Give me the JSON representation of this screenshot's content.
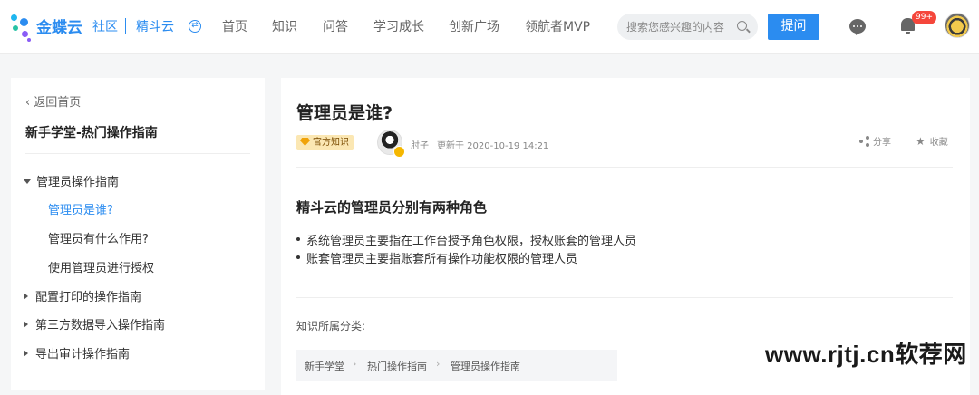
{
  "header": {
    "brand": "金蝶云",
    "brand_sub": "社区",
    "product": "精斗云",
    "nav": [
      "首页",
      "知识",
      "问答",
      "学习成长",
      "创新广场",
      "领航者MVP"
    ],
    "search_placeholder": "搜索您感兴趣的内容",
    "ask_label": "提问",
    "badge": "99+"
  },
  "sidebar": {
    "back_label": "返回首页",
    "title": "新手学堂-热门操作指南",
    "group": "管理员操作指南",
    "children": [
      "管理员是谁?",
      "管理员有什么作用?",
      "使用管理员进行授权"
    ],
    "collapsed": [
      "配置打印的操作指南",
      "第三方数据导入操作指南",
      "导出审计操作指南"
    ]
  },
  "article": {
    "title": "管理员是谁?",
    "official_tag": "官方知识",
    "author": "肘子",
    "updated": "更新于 2020-10-19 14:21",
    "share_label": "分享",
    "fav_label": "收藏",
    "section_heading": "精斗云的管理员分别有两种角色",
    "bullets": [
      "系统管理员主要指在工作台授予角色权限，授权账套的管理人员",
      "账套管理员主要指账套所有操作功能权限的管理人员"
    ],
    "category_label": "知识所属分类:",
    "breadcrumb": [
      "新手学堂",
      "热门操作指南",
      "管理员操作指南"
    ]
  },
  "watermark": "www.rjtj.cn软荐网",
  "colors": {
    "accent": "#2b8cf0",
    "badge": "#f5463b",
    "official_bg": "#fbe7b3"
  }
}
